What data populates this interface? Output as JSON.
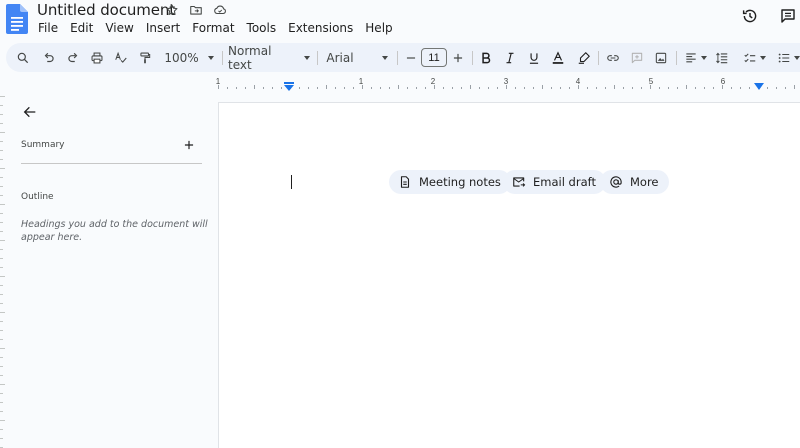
{
  "app": {
    "doc_title": "Untitled document",
    "icons": [
      "docs-logo-icon",
      "star-icon",
      "move-folder-icon",
      "cloud-saved-icon",
      "version-history-icon",
      "comments-icon"
    ]
  },
  "menu": [
    "File",
    "Edit",
    "View",
    "Insert",
    "Format",
    "Tools",
    "Extensions",
    "Help"
  ],
  "toolbar": {
    "zoom": "100%",
    "style": "Normal text",
    "font": "Arial",
    "font_size": "11",
    "icons": [
      "search-menus-icon",
      "undo-icon",
      "redo-icon",
      "print-icon",
      "spellcheck-icon",
      "paint-format-icon",
      "decrease-font-size-icon",
      "increase-font-size-icon",
      "bold-icon",
      "italic-icon",
      "underline-icon",
      "text-color-icon",
      "highlight-icon",
      "insert-link-icon",
      "add-comment-icon",
      "insert-image-icon",
      "align-icon",
      "line-spacing-icon",
      "checklist-icon",
      "bulleted-list-icon"
    ]
  },
  "ruler": {
    "numbers": [
      "1",
      "1",
      "2",
      "3",
      "4",
      "5",
      "6"
    ]
  },
  "sidebar": {
    "summary_label": "Summary",
    "outline_label": "Outline",
    "outline_hint": "Headings you add to the document will appear here."
  },
  "document": {
    "chips": [
      {
        "label": "Meeting notes",
        "icon": "document-icon"
      },
      {
        "label": "Email draft",
        "icon": "email-icon"
      },
      {
        "label": "More",
        "icon": "at-sign-icon"
      }
    ]
  },
  "colors": {
    "accent": "#1a73e8",
    "toolbar_bg": "#edf2fa",
    "background": "#f9fbfd",
    "page": "#ffffff"
  }
}
